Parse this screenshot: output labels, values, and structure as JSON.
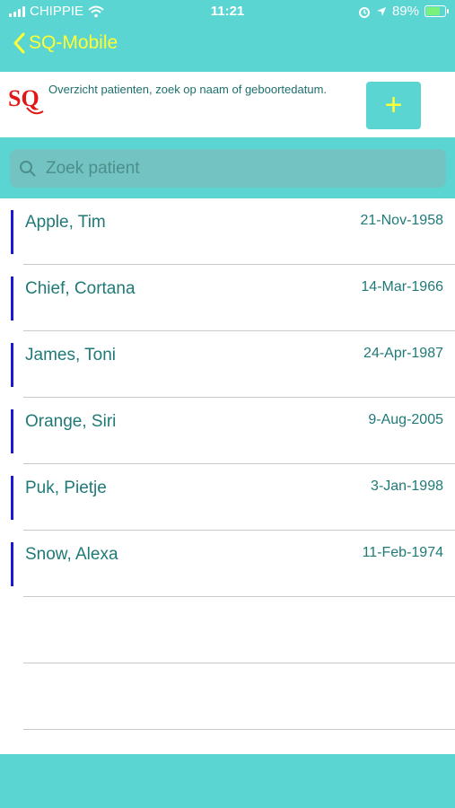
{
  "status_bar": {
    "carrier": "CHIPPIE",
    "time": "11:21",
    "battery": "89%",
    "battery_level": 0.89
  },
  "nav": {
    "back_label": "SQ-Mobile"
  },
  "header": {
    "logo_text": "SQ",
    "description": "Overzicht patienten, zoek op naam of geboortedatum.",
    "add_label": "+"
  },
  "search": {
    "placeholder": "Zoek patient"
  },
  "patients": [
    {
      "name": "Apple, Tim",
      "dob": "21-Nov-1958"
    },
    {
      "name": "Chief, Cortana",
      "dob": "14-Mar-1966"
    },
    {
      "name": "James, Toni",
      "dob": "24-Apr-1987"
    },
    {
      "name": "Orange, Siri",
      "dob": "9-Aug-2005"
    },
    {
      "name": "Puk, Pietje",
      "dob": "3-Jan-1998"
    },
    {
      "name": "Snow, Alexa",
      "dob": "11-Feb-1974"
    }
  ],
  "colors": {
    "accent": "#5ad5d2",
    "nav_text": "#ffff33",
    "list_text": "#1f7a77",
    "row_marker": "#1a1ad6",
    "logo_red": "#e01818"
  },
  "icons": [
    "signal-icon",
    "wifi-icon",
    "alarm-icon",
    "location-icon",
    "battery-icon",
    "chevron-left-icon",
    "search-icon"
  ]
}
